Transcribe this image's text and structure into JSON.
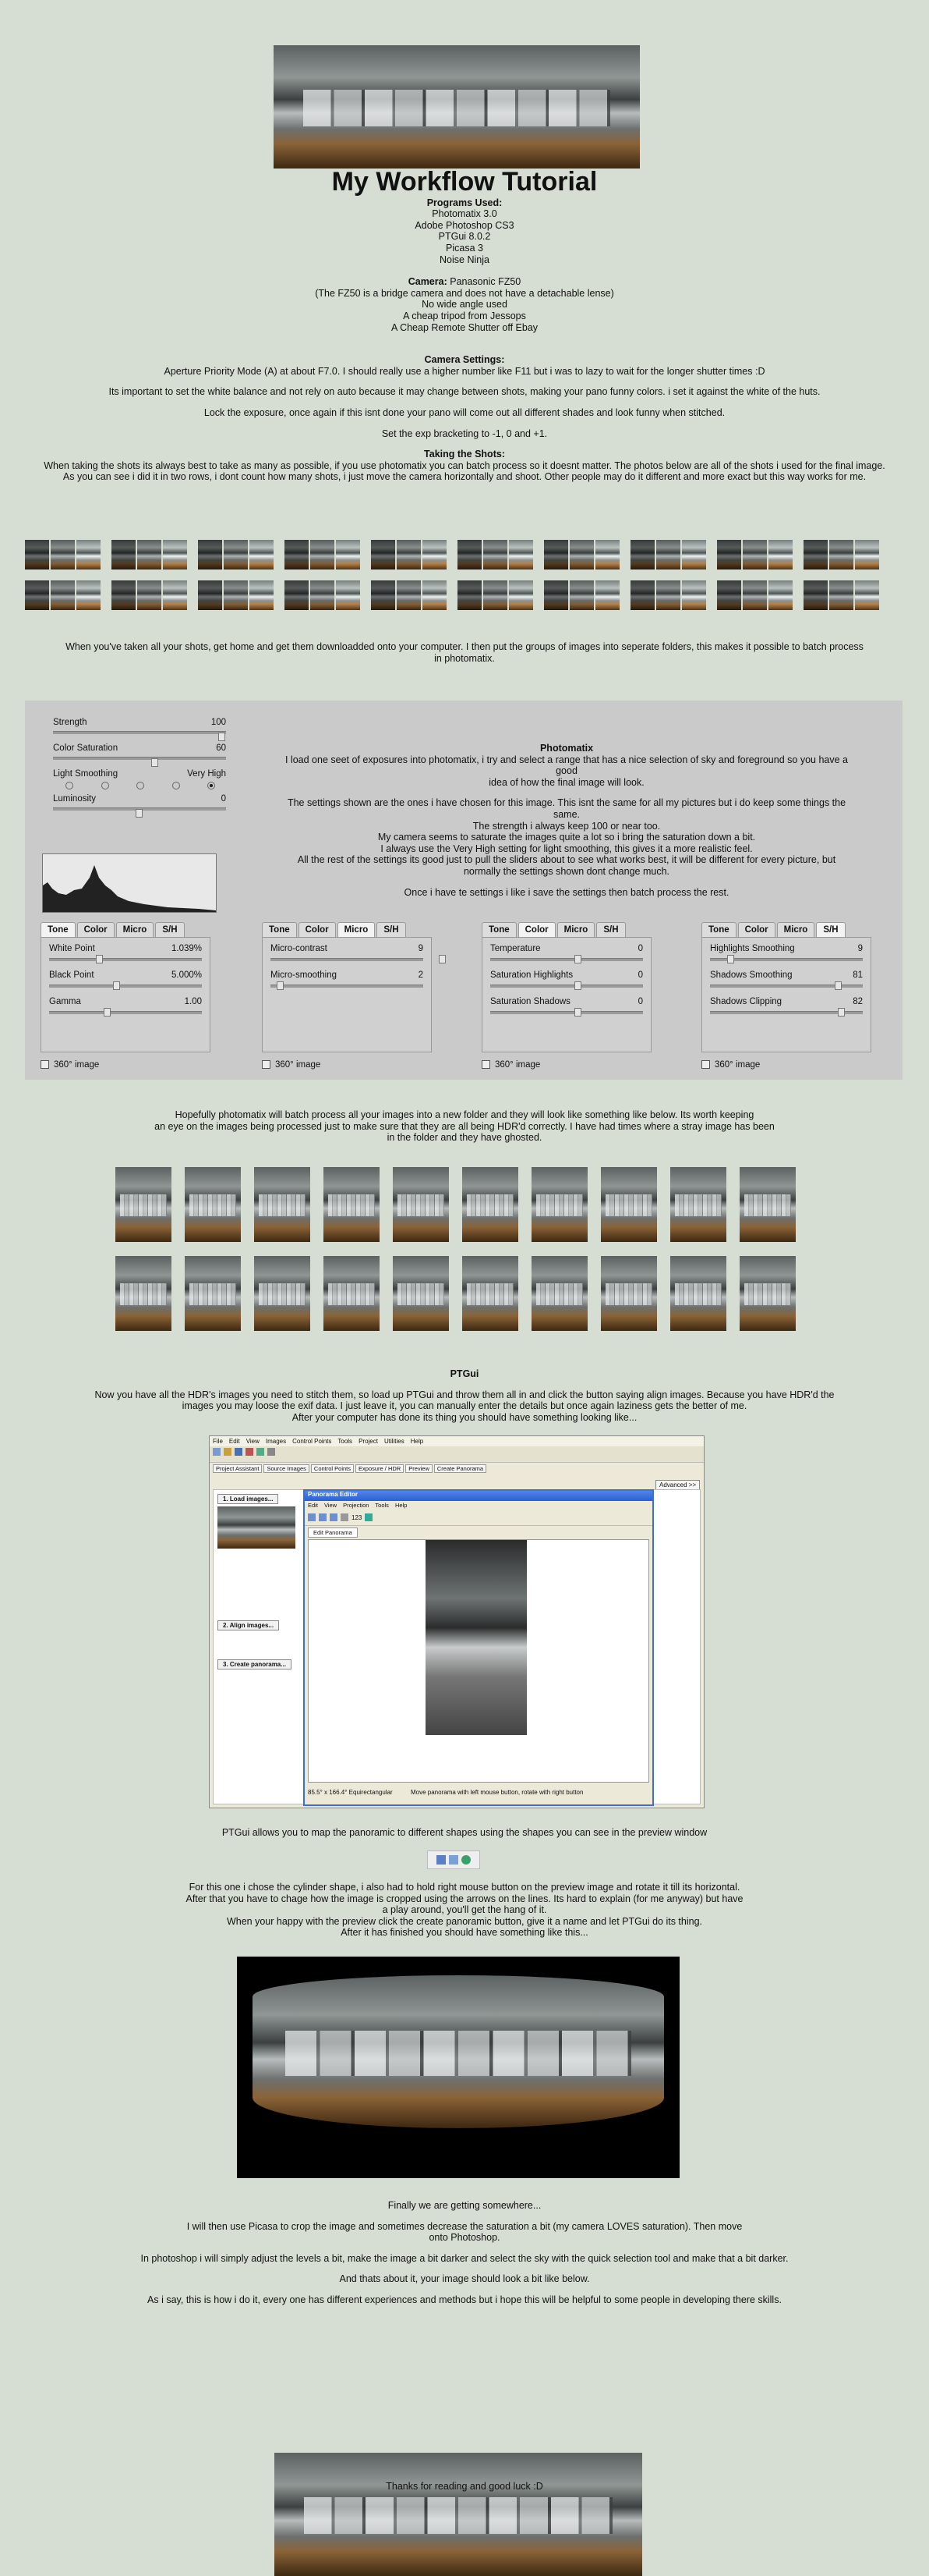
{
  "title": "My Workflow Tutorial",
  "programs": {
    "heading": "Programs Used:",
    "items": [
      "Photomatix 3.0",
      "Adobe Photoshop CS3",
      "PTGui 8.0.2",
      "Picasa 3",
      "Noise Ninja"
    ]
  },
  "camera": {
    "label": "Camera:",
    "model": "Panasonic FZ50",
    "lines": [
      "(The FZ50 is a bridge camera and does not have a detachable lense)",
      "No wide angle used",
      "A cheap tripod from Jessops",
      "A Cheap Remote Shutter off Ebay"
    ]
  },
  "settings": {
    "heading": "Camera Settings:",
    "p1": "Aperture Priority Mode (A) at about F7.0. I should really use a higher number like F11 but i was to lazy to wait for the longer shutter times :D",
    "p2": "Its important to set the white balance and not rely on auto because it may change between shots, making your pano funny colors. i set it against the white of the huts.",
    "p3": "Lock the exposure, once again if this isnt done your pano will come out all different shades and look funny when stitched.",
    "p4": "Set the exp bracketing to -1, 0 and +1."
  },
  "shots": {
    "heading": "Taking the Shots:",
    "line1": "When taking the shots its always best to take as many as possible, if you use photomatix you can batch process so it doesnt matter. The photos below are all of the shots i used for the final image.",
    "line2": "As you can see i did it in two rows, i dont count how many shots, i just move the camera horizontally and shoot. Other people may do it different and more exact but this way works for me."
  },
  "download": {
    "line1": "When you've taken all your shots, get home and get them downloadded onto your computer. I then put the groups of images into seperate folders, this makes it possible to batch process",
    "line2": "in photomatix."
  },
  "photomatix": {
    "top": {
      "strength_label": "Strength",
      "strength_val": "100",
      "sat_label": "Color Saturation",
      "sat_val": "60",
      "ls_label": "Light Smoothing",
      "ls_high": "Very High",
      "lum_label": "Luminosity",
      "lum_val": "0"
    },
    "heading": "Photomatix",
    "p1a": "I load one seet of exposures into photomatix, i try and select a range that has a nice selection of sky and foreground so you have a good",
    "p1b": "idea of how the final image will look.",
    "p2": [
      "The settings shown are the ones i have chosen for this image. This isnt the same for all my pictures but i do keep some things the same.",
      "The strength i always keep 100 or near too.",
      "My camera seems to saturate the images quite a lot so i bring the saturation down a bit.",
      "I always use the Very High setting for light smoothing, this gives it a more realistic feel.",
      "All the rest of the settings its good just to pull the sliders about to see what works best, it will be different for every picture, but",
      "normally the settings shown dont change much."
    ],
    "p3": "Once i have te settings i like i save the settings then batch process the rest.",
    "tabs": [
      "Tone",
      "Color",
      "Micro",
      "S/H"
    ],
    "p360": "360° image",
    "panels": [
      {
        "active": 0,
        "rows": [
          {
            "label": "White Point",
            "val": "1.039%"
          },
          {
            "label": "Black Point",
            "val": "5.000%"
          },
          {
            "label": "Gamma",
            "val": "1.00"
          }
        ]
      },
      {
        "active": 2,
        "rows": [
          {
            "label": "Micro-contrast",
            "val": "9"
          },
          {
            "label": "Micro-smoothing",
            "val": "2"
          }
        ]
      },
      {
        "active": 1,
        "rows": [
          {
            "label": "Temperature",
            "val": "0"
          },
          {
            "label": "Saturation Highlights",
            "val": "0"
          },
          {
            "label": "Saturation Shadows",
            "val": "0"
          }
        ]
      },
      {
        "active": 3,
        "rows": [
          {
            "label": "Highlights Smoothing",
            "val": "9"
          },
          {
            "label": "Shadows Smoothing",
            "val": "81"
          },
          {
            "label": "Shadows Clipping",
            "val": "82"
          }
        ]
      }
    ]
  },
  "hdr": {
    "line1": "Hopefully photomatix will batch process all your images into a new folder and they will look like something like below. Its worth keeping",
    "line2": "an eye on the images being processed just to make sure that they are all being HDR'd correctly. I have had times where a stray image has been",
    "line3": "in the folder and they have ghosted."
  },
  "ptgui": {
    "heading": "PTGui",
    "line1": "Now you have all the HDR's images you need to stitch them, so load up PTGui and throw them all in and click the button saying align images. Because you have HDR'd the",
    "line2": "images you may loose the exif data. I just leave it, you can manually enter the details but once again laziness gets the better of me.",
    "line3": "After your computer has done its thing you should have something looking like...",
    "menu": [
      "File",
      "Edit",
      "View",
      "Images",
      "Control Points",
      "Tools",
      "Project",
      "Utilities",
      "Help"
    ],
    "tabs": [
      "Project Assistant",
      "Source Images",
      "Control Points",
      "Exposure / HDR",
      "Preview",
      "Create Panorama"
    ],
    "advanced": "Advanced >>",
    "load": "1. Load images...",
    "align": "2. Align images...",
    "create": "3. Create panorama...",
    "editor_title": "Panorama Editor",
    "editor_menu": [
      "Edit",
      "View",
      "Projection",
      "Tools",
      "Help"
    ],
    "editor_tab": "Edit Panorama",
    "zoom": "123",
    "status_left": "85.5° x 166.4° Equirectangular",
    "status_right": "Move panorama with left mouse button, rotate with right button",
    "caption": "PTGui allows you to map the panoramic to different shapes using the shapes you can see in the preview window",
    "p1": "For this one i chose the cylinder shape, i also had to hold right mouse button on the preview image and rotate it till its horizontal.",
    "p2": "After that you have to chage how the image is cropped using the arrows on the lines. Its hard to explain (for me anyway) but have",
    "p3": "a play around, you'll get the hang of it.",
    "p4": "When your happy with the preview click the create panoramic button, give it a name and let PTGui do its thing.",
    "p5": "After it has finished you should have something like this..."
  },
  "final": {
    "p1": "Finally we are getting somewhere...",
    "p2a": "I will then use Picasa to crop the image and sometimes decrease the saturation a bit (my camera LOVES saturation). Then move",
    "p2b": "onto Photoshop.",
    "p3": "In photoshop i will simply adjust the levels a bit, make the image a bit darker and select the sky with the quick selection tool and make that a bit darker.",
    "p4": "And thats about it, your image should look a bit like below.",
    "p5": "As i say, this is how i do it, every one has different experiences and methods but i hope this will be helpful to some people in developing there skills.",
    "thanks": "Thanks for reading and good luck :D"
  }
}
